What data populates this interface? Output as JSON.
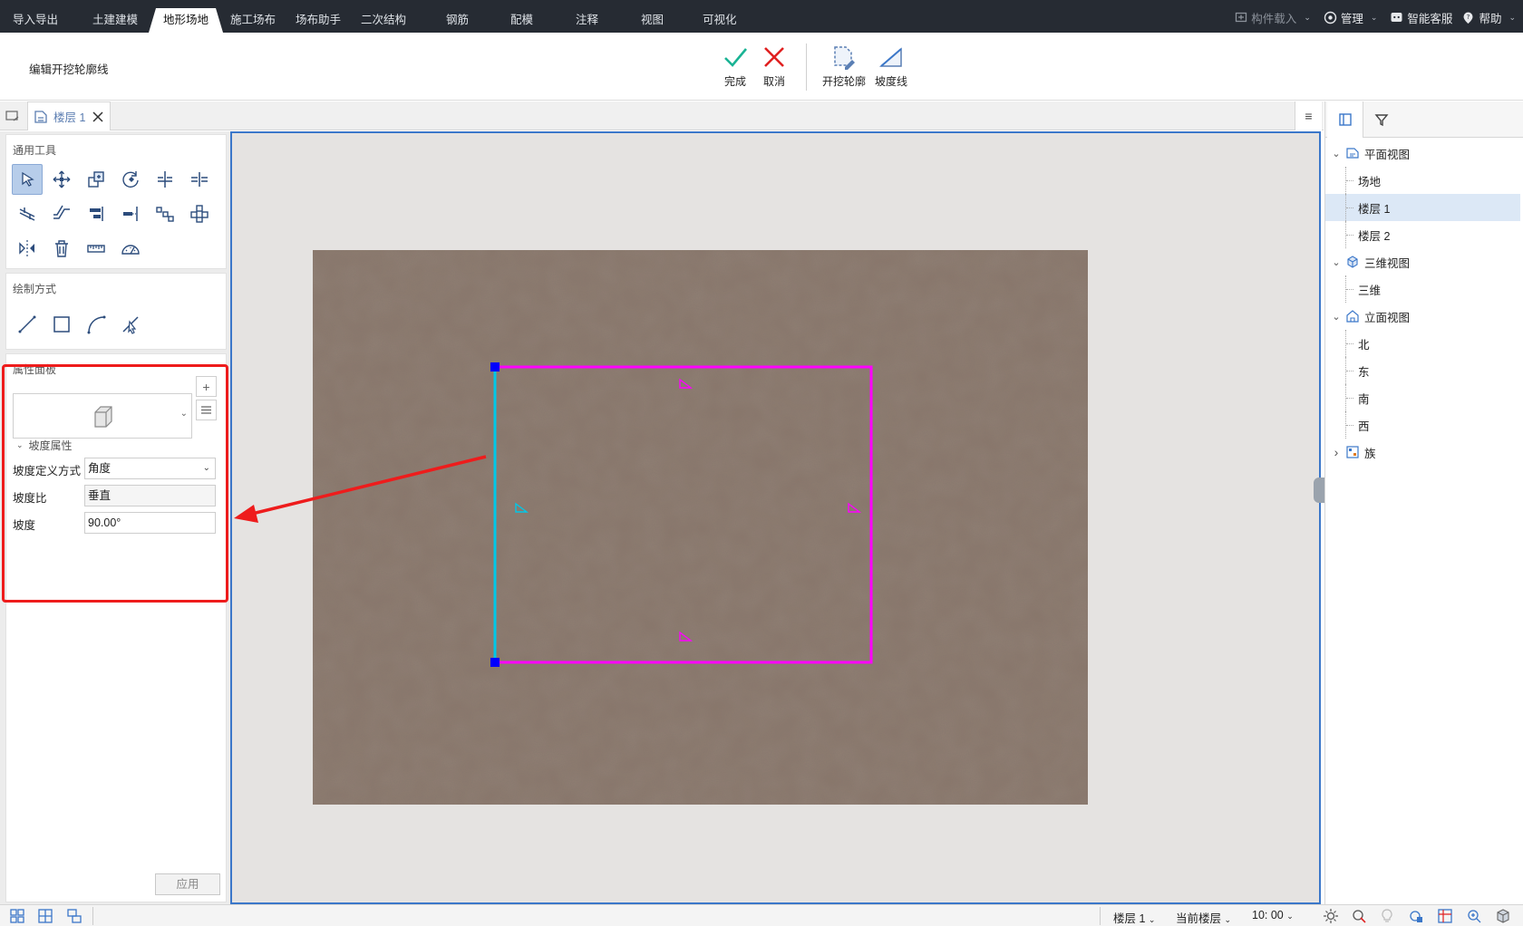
{
  "menu_tabs": [
    "导入导出",
    "土建建模",
    "地形场地",
    "施工场布",
    "场布助手",
    "二次结构",
    "钢筋",
    "配模",
    "注释",
    "视图",
    "可视化"
  ],
  "active_tab": "地形场地",
  "top_right": {
    "component_load": "构件载入",
    "manage": "管理",
    "service": "智能客服",
    "help": "帮助"
  },
  "ribbon": {
    "title": "编辑开挖轮廓线",
    "finish": "完成",
    "cancel": "取消",
    "excavation_outline": "开挖轮廓",
    "slope_line": "坡度线"
  },
  "doc_tab": {
    "label": "楼层 1"
  },
  "left_panel": {
    "general_tools_title": "通用工具",
    "draw_mode_title": "绘制方式",
    "property_panel_title": "属性面板",
    "slope_section": "坡度属性",
    "rows": [
      {
        "label": "坡度定义方式",
        "value": "角度"
      },
      {
        "label": "坡度比",
        "value": "垂直"
      },
      {
        "label": "坡度",
        "value": "90.00°"
      }
    ],
    "apply": "应用"
  },
  "tree": [
    {
      "label": "平面视图",
      "level": 0,
      "expanded": true,
      "icon": "floorplan-icon"
    },
    {
      "label": "场地",
      "level": 1
    },
    {
      "label": "楼层 1",
      "level": 1,
      "selected": true
    },
    {
      "label": "楼层 2",
      "level": 1
    },
    {
      "label": "三维视图",
      "level": 0,
      "expanded": true,
      "icon": "cube-icon"
    },
    {
      "label": "三维",
      "level": 1
    },
    {
      "label": "立面视图",
      "level": 0,
      "expanded": true,
      "icon": "elevation-icon"
    },
    {
      "label": "北",
      "level": 1
    },
    {
      "label": "东",
      "level": 1
    },
    {
      "label": "南",
      "level": 1
    },
    {
      "label": "西",
      "level": 1
    },
    {
      "label": "族",
      "level": 0,
      "expanded": false,
      "icon": "family-icon"
    }
  ],
  "status": {
    "floor": "楼层 1",
    "current": "当前楼层",
    "scale": "10: 00"
  },
  "colors": {
    "accent": "#3b77c9",
    "outline": "#ff00ff",
    "selected_edge": "#00c8e8",
    "handle": "#0000ff",
    "annotation": "#ee1c1c",
    "terrain": "#8a766a"
  }
}
